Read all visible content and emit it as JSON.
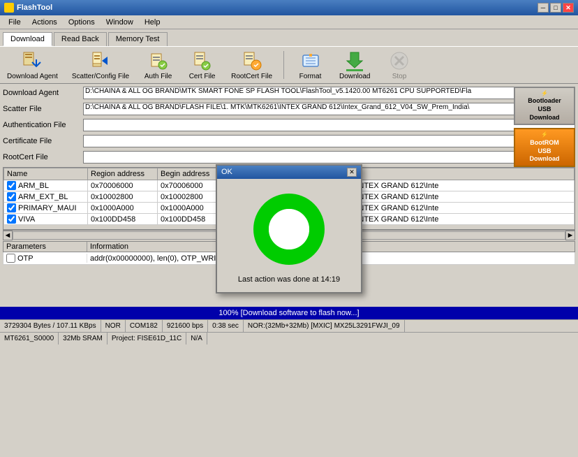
{
  "window": {
    "title": "FlashTool",
    "icon": "flash-icon"
  },
  "titlebar": {
    "controls": {
      "minimize": "─",
      "maximize": "□",
      "close": "✕"
    }
  },
  "menubar": {
    "items": [
      "File",
      "Actions",
      "Options",
      "Window",
      "Help"
    ]
  },
  "tabs": [
    {
      "label": "Download",
      "active": true
    },
    {
      "label": "Read Back",
      "active": false
    },
    {
      "label": "Memory Test",
      "active": false
    }
  ],
  "toolbar": {
    "items": [
      {
        "label": "Download Agent",
        "icon": "download-agent-icon"
      },
      {
        "label": "Scatter/Config File",
        "icon": "scatter-icon"
      },
      {
        "label": "Auth File",
        "icon": "auth-icon"
      },
      {
        "label": "Cert File",
        "icon": "cert-icon"
      },
      {
        "label": "RootCert File",
        "icon": "rootcert-icon"
      },
      {
        "label": "Format",
        "icon": "format-icon"
      },
      {
        "label": "Download",
        "icon": "download-icon"
      },
      {
        "label": "Stop",
        "icon": "stop-icon",
        "disabled": true
      }
    ]
  },
  "form": {
    "rows": [
      {
        "label": "Download Agent",
        "value": "D:\\CHAINA & ALL OG BRAND\\MTK SMART FONE SP FLASH TOOL\\FlashTool_v5.1420.00 MT6261 CPU SUPPORTED\\Fla"
      },
      {
        "label": "Scatter File",
        "value": "D:\\CHAINA & ALL OG BRAND\\FLASH FILE\\1. MTK\\MTK6261\\INTEX GRAND 612\\Intex_Grand_612_V04_SW_Prem_India\\"
      },
      {
        "label": "Authentication File",
        "value": ""
      },
      {
        "label": "Certificate File",
        "value": ""
      },
      {
        "label": "RootCert File",
        "value": ""
      }
    ]
  },
  "side_buttons": [
    {
      "label": "Bootloader\nUSB\nDownload",
      "style": "normal"
    },
    {
      "label": "BootROM\nUSB\nDownload",
      "style": "orange"
    }
  ],
  "table": {
    "columns": [
      "Name",
      "Region address",
      "Begin address"
    ],
    "rows": [
      {
        "checked": true,
        "name": "ARM_BL",
        "region": "0x70006000",
        "begin": "0x70006000",
        "path": "AND\\FLASH FILE\\1. MTK\\MTK6261\\INTEX GRAND 612\\Inte"
      },
      {
        "checked": true,
        "name": "ARM_EXT_BL",
        "region": "0x10002800",
        "begin": "0x10002800",
        "path": "AND\\FLASH FILE\\1. MTK\\MTK6261\\INTEX GRAND 612\\Inte"
      },
      {
        "checked": true,
        "name": "PRIMARY_MAUI",
        "region": "0x1000A000",
        "begin": "0x1000A000",
        "path": "AND\\FLASH FILE\\1. MTK\\MTK6261\\INTEX GRAND 612\\Inte"
      },
      {
        "checked": true,
        "name": "VIVA",
        "region": "0x100DD458",
        "begin": "0x100DD458",
        "path": "AND\\FLASH FILE\\1. MTK\\MTK6261\\INTEX GRAND 612\\Inte"
      }
    ]
  },
  "bottom_table": {
    "columns": [
      "Parameters",
      "Information"
    ],
    "rows": [
      {
        "param": "OTP",
        "info": "addr(0x00000000), len(0), OTP_WRITE."
      }
    ]
  },
  "dialog": {
    "title": "OK",
    "status_text": "Last action was done at 14:19",
    "donut_color": "#00cc00",
    "donut_bg": "white"
  },
  "progress": {
    "text": "100% [Download software to flash now...]",
    "percent": 100
  },
  "status_bar_1": {
    "segments": [
      "3729304 Bytes / 107.11 KBps",
      "NOR",
      "COM182",
      "921600 bps",
      "0:38 sec",
      "NOR:(32Mb+32Mb) [MXIC] MX25L3291FWJI_09"
    ]
  },
  "status_bar_2": {
    "segments": [
      "MT6261_S0000",
      "32Mb SRAM",
      "Project: FISE61D_11C",
      "N/A"
    ]
  }
}
